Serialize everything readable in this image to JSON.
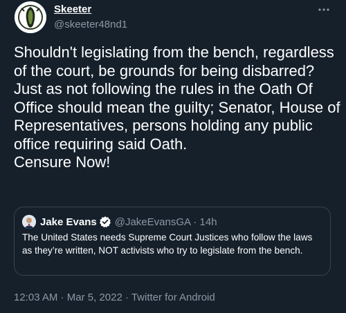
{
  "author": {
    "display_name": "Skeeter",
    "handle": "@skeeter48nd1",
    "avatar_icon": "alien-emblem-avatar"
  },
  "tweet": {
    "text": "Shouldn't legislating from the bench, regardless of the court, be grounds for being disbarred?\nJust as not following the rules in the Oath Of Office should mean the guilty; Senator, House of Representatives, persons holding any public office requiring said Oath.\nCensure Now!"
  },
  "quoted_tweet": {
    "display_name": "Jake Evans",
    "handle_time": "@JakeEvansGA · 14h",
    "text": "The United States needs Supreme Court Justices who follow the laws as they’re written, NOT activists who try to legislate from the bench.",
    "verified": true
  },
  "meta": {
    "time": "12:03 AM",
    "separator1": " · ",
    "date": "Mar 5, 2022",
    "separator2": " · ",
    "source": "Twitter for Android"
  },
  "colors": {
    "background": "#15202b",
    "secondary_text": "#8b98a5",
    "border": "#38444d",
    "verified": "#1d9bf0"
  }
}
